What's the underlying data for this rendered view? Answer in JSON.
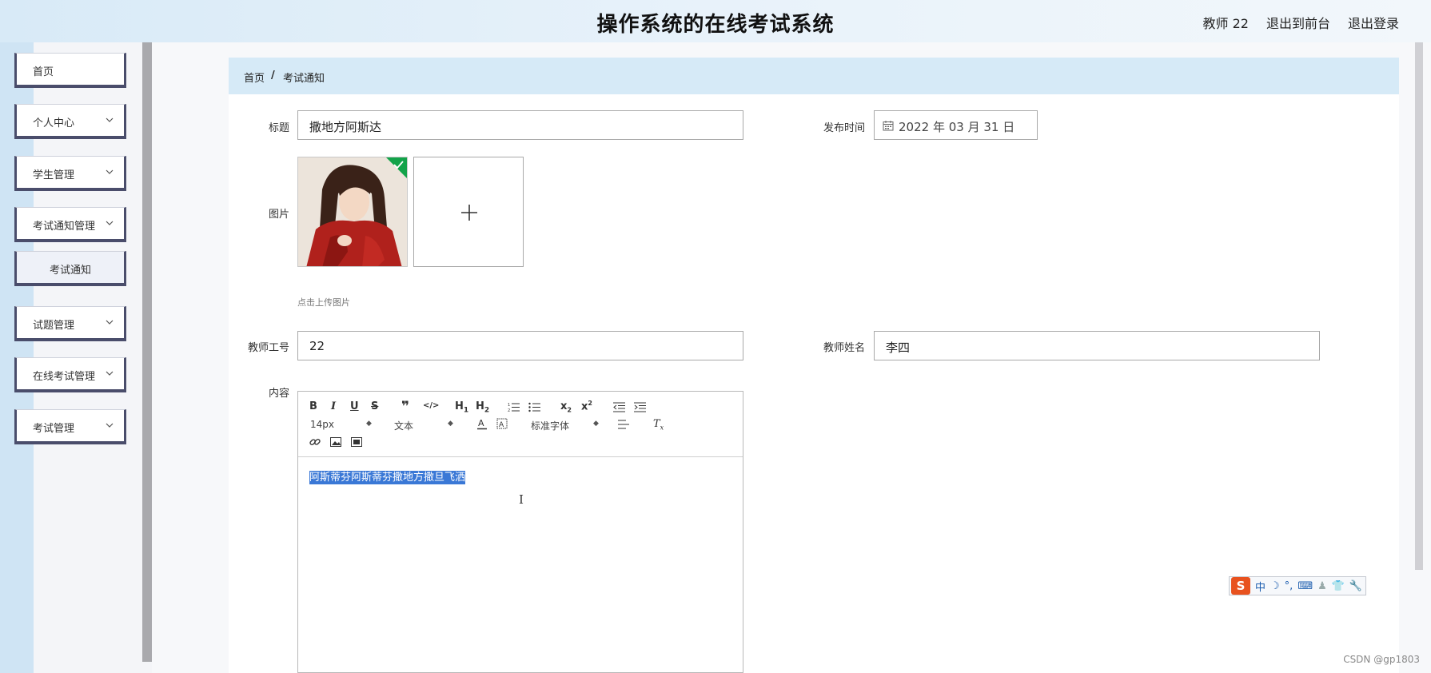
{
  "header": {
    "title": "操作系统的在线考试系统",
    "user": "教师 22",
    "back_to_front": "退出到前台",
    "logout": "退出登录"
  },
  "sidebar": {
    "items": [
      {
        "label": "首页",
        "has_children": false
      },
      {
        "label": "个人中心",
        "has_children": true
      },
      {
        "label": "学生管理",
        "has_children": true
      },
      {
        "label": "考试通知管理",
        "has_children": true
      },
      {
        "label": "考试通知",
        "has_children": false,
        "sub": true
      },
      {
        "label": "试题管理",
        "has_children": true
      },
      {
        "label": "在线考试管理",
        "has_children": true
      },
      {
        "label": "考试管理",
        "has_children": true
      }
    ]
  },
  "breadcrumb": {
    "home": "首页",
    "separator": "/",
    "current": "考试通知"
  },
  "form": {
    "title_label": "标题",
    "title_value": "撒地方阿斯达",
    "publish_time_label": "发布时间",
    "publish_time_value": "2022 年 03 月 31 日",
    "image_label": "图片",
    "upload_hint": "点击上传图片",
    "teacher_id_label": "教师工号",
    "teacher_id_value": "22",
    "teacher_name_label": "教师姓名",
    "teacher_name_value": "李四",
    "content_label": "内容"
  },
  "editor": {
    "font_size": "14px",
    "block_type": "文本",
    "font_family": "标准字体",
    "content_text": "阿斯蒂芬阿斯蒂芬撒地方撒旦飞洒"
  },
  "ime": {
    "lang": "中"
  },
  "watermark": "CSDN @gp1803",
  "colors": {
    "header_bg": "#d8eaf7",
    "breadcrumb_bg": "#d6eaf7",
    "sidebar_border": "#4a4d6b",
    "selection": "#3a78d6",
    "upload_success": "#13a34a"
  }
}
